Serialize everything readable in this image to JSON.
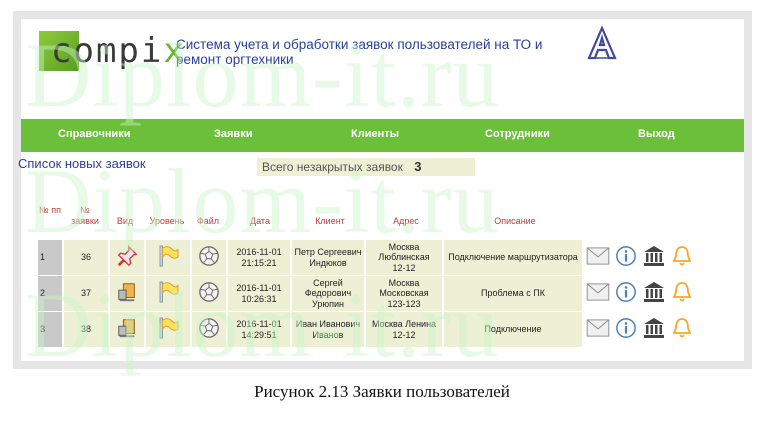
{
  "header": {
    "logo_text": "compix",
    "app_title": "Система учета и обработки заявок пользователей на ТО и ремонт оргтехники",
    "badge_logo_icon": "letter-a-logo-icon"
  },
  "nav": {
    "items": [
      "Справочники",
      "Заявки",
      "Клиенты",
      "Сотрудники",
      "Выход"
    ]
  },
  "list": {
    "title": "Список новых заявок",
    "open_label": "Всего незакрытых заявок",
    "open_count": "3"
  },
  "table": {
    "headers": [
      "№ пп",
      "№ заявки",
      "Вид",
      "Уровень",
      "Файл",
      "Дата",
      "Клиент",
      "Адрес",
      "Описание"
    ],
    "rows": [
      {
        "pp": "1",
        "num": "36",
        "kind_icon": "pushpin-icon",
        "level_icon": "flag-icon",
        "file_icon": "ball-icon",
        "date": "2016-11-01",
        "time": "21:15:21",
        "client": [
          "Петр Сергеевич",
          "Индюков"
        ],
        "address": [
          "Москва",
          "Люблинская",
          "12-12"
        ],
        "description": "Подключение маршрутизатора"
      },
      {
        "pp": "2",
        "num": "37",
        "kind_icon": "computer-icon",
        "level_icon": "flag-icon",
        "file_icon": "ball-icon",
        "date": "2016-11-01",
        "time": "10:26:31",
        "client": [
          "Сергей",
          "Федорович",
          "Урюпин"
        ],
        "address": [
          "Москва",
          "Московская",
          "123-123"
        ],
        "description": "Проблема с ПК"
      },
      {
        "pp": "3",
        "num": "38",
        "kind_icon": "computer-icon",
        "level_icon": "flag-icon",
        "file_icon": "ball-icon",
        "date": "2016-11-01",
        "time": "14:29:51",
        "client": [
          "Иван Иванович",
          "Иванов"
        ],
        "address": [
          "Москва Ленина",
          "12-12"
        ],
        "description": "Подключение"
      }
    ],
    "action_icons": [
      "envelope-icon",
      "info-icon",
      "bank-icon",
      "bell-icon"
    ]
  },
  "caption": "Рисунок 2.13 Заявки пользователей",
  "watermark": "Diplom-it.ru",
  "colors": {
    "nav_green": "#6cbf39",
    "title_blue": "#2a3f9a",
    "header_red": "#c13b3b",
    "cell_bg": "#eef0d6",
    "watermark_green": "#c8f5c8"
  }
}
